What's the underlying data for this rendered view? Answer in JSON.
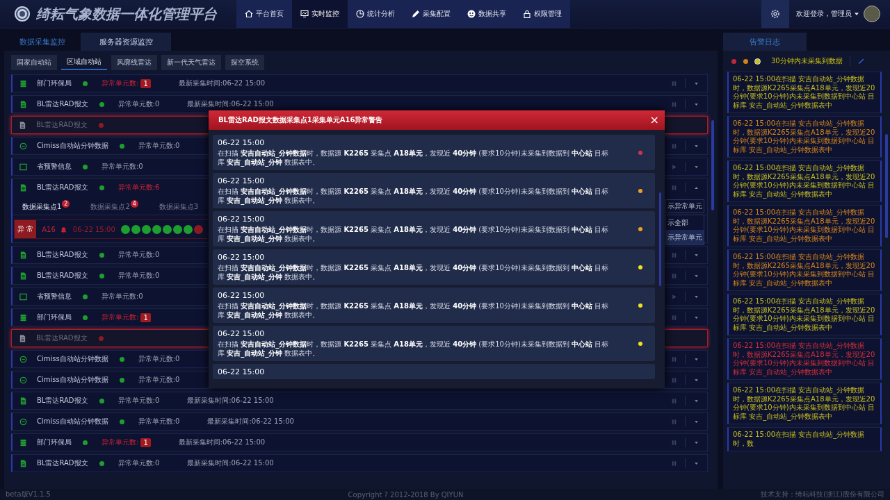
{
  "header": {
    "title": "绮耘气象数据一体化管理平台",
    "nav": [
      {
        "label": "平台首页",
        "selected": false
      },
      {
        "label": "实时监控",
        "selected": true
      },
      {
        "label": "统计分析",
        "selected": false
      },
      {
        "label": "采集配置",
        "selected": false
      },
      {
        "label": "数据共享",
        "selected": false
      },
      {
        "label": "权限管理",
        "selected": false
      }
    ],
    "welcome": "欢迎登录，管理员"
  },
  "main_tabs": [
    {
      "label": "数据采集监控",
      "selected": false
    },
    {
      "label": "服务器资源监控",
      "selected": true
    }
  ],
  "station_tabs": [
    {
      "label": "国家自动站",
      "selected": false
    },
    {
      "label": "区域自动站",
      "selected": true
    },
    {
      "label": "风廓线雷达",
      "selected": false
    },
    {
      "label": "新一代天气雷达",
      "selected": false
    },
    {
      "label": "探空系统",
      "selected": false
    }
  ],
  "rows": [
    {
      "kind": "database",
      "name": "部门环保局",
      "alarm": false,
      "count": "异常单元数:",
      "warning": true,
      "badge": "1",
      "updated": "最新采集时间:06-22 15:00",
      "running": true,
      "expanded": false
    },
    {
      "kind": "document",
      "name": "BL雷达RAD报文",
      "alarm": false,
      "count": "异常单元数:0",
      "warning": false,
      "updated": "最新采集时间:06-22 15:00",
      "running": true,
      "expanded": false
    },
    {
      "kind": "document",
      "name": "BL雷达RAD报文",
      "alarm": true
    },
    {
      "kind": "circle",
      "name": "Cimiss自动站分钟数据",
      "alarm": false,
      "count": "异常单元数:0",
      "warning": false,
      "running": true,
      "expanded": false
    },
    {
      "kind": "window",
      "name": "省预警信息",
      "alarm": false,
      "count": "异常单元数:0",
      "warning": false,
      "running": false,
      "expanded": false
    },
    {
      "kind": "document",
      "name": "BL雷达RAD报文",
      "alarm": false,
      "count": "异常单元数:6",
      "warning": true,
      "running": true,
      "expanded": true,
      "points": [
        {
          "label": "数据采集点1",
          "badge": "2",
          "selected": true
        },
        {
          "label": "数据采集点2",
          "badge": "4",
          "selected": false
        },
        {
          "label": "数据采集点3",
          "selected": false
        }
      ],
      "unit": {
        "status": "异 常",
        "name": "A16",
        "time": "06-22 15:00",
        "cells": [
          {
            "color": "#1e9e2e"
          },
          {
            "color": "#1e9e2e"
          },
          {
            "color": "#1e9e2e"
          },
          {
            "color": "#1e9e2e"
          },
          {
            "color": "#1e9e2e"
          },
          {
            "color": "#1e9e2e"
          },
          {
            "color": "#1e9e2e"
          },
          {
            "color": "#8e1a22"
          }
        ]
      },
      "filter": {
        "value": "示异常单元",
        "options": [
          {
            "label": "示全部",
            "selected": false
          },
          {
            "label": "示异常单元",
            "selected": true
          }
        ]
      }
    },
    {
      "kind": "document",
      "name": "BL雷达RAD报文",
      "alarm": false,
      "count": "异常单元数:0",
      "warning": false,
      "running": true,
      "expanded": false
    },
    {
      "kind": "document",
      "name": "BL雷达RAD报文",
      "alarm": false,
      "count": "异常单元数:0",
      "warning": false,
      "running": true,
      "expanded": false
    },
    {
      "kind": "window",
      "name": "省预警信息",
      "alarm": false,
      "count": "异常单元数:0",
      "warning": false,
      "running": false,
      "expanded": false
    },
    {
      "kind": "database",
      "name": "部门环保局",
      "alarm": false,
      "count": "异常单元数:",
      "warning": true,
      "badge": "1",
      "running": true,
      "expanded": false
    },
    {
      "kind": "document",
      "name": "BL雷达RAD报文",
      "alarm": true
    },
    {
      "kind": "circle",
      "name": "Cimiss自动站分钟数据",
      "alarm": false,
      "count": "异常单元数:0",
      "warning": false,
      "running": true,
      "expanded": false
    },
    {
      "kind": "circle",
      "name": "Cimiss自动站分钟数据",
      "alarm": false,
      "count": "异常单元数:0",
      "warning": false,
      "running": true,
      "expanded": false
    },
    {
      "kind": "document",
      "name": "BL雷达RAD报文",
      "alarm": false,
      "count": "异常单元数:0",
      "warning": false,
      "updated": "最新采集时间:06-22 15:00",
      "running": true,
      "expanded": false
    },
    {
      "kind": "circle",
      "name": "Cimiss自动站分钟数据",
      "alarm": false,
      "count": "异常单元数:0",
      "warning": false,
      "updated": "最新采集时间:06-22 15:00",
      "running": true,
      "expanded": false
    },
    {
      "kind": "database",
      "name": "部门环保局",
      "alarm": false,
      "count": "异常单元数:",
      "warning": true,
      "badge": "1",
      "updated": "最新采集时间:06-22 15:00",
      "running": true,
      "expanded": false
    },
    {
      "kind": "document",
      "name": "BL雷达RAD报文",
      "alarm": false,
      "count": "异常单元数:0",
      "warning": false,
      "updated": "最新采集时间:06-22 15:00",
      "running": true,
      "expanded": false
    }
  ],
  "alert_log": {
    "tab": "告警日志",
    "levels": [
      {
        "color": "#c0283a",
        "selected": false
      },
      {
        "color": "#d08418",
        "selected": false
      },
      {
        "color": "#c8c018",
        "selected": true
      }
    ],
    "filter_label": "30分钟内未采集到数据",
    "entries": [
      {
        "color": "#c8c020",
        "text": "06-22 15:00在扫描 安吉自动站_分钟数据时，数据源K2265采集点A18单元，发现近20分钟(要求10分钟)内未采集到数据到中心站 目标库 安吉_自动站_分钟数据表中"
      },
      {
        "color": "#d8881c",
        "text": "06-22 15:00在扫描 安吉自动站_分钟数据时，数据源K2265采集点A18单元，发现近20分钟(要求10分钟)内未采集到数据到中心站 目标库 安吉_自动站_分钟数据表中"
      },
      {
        "color": "#c8c020",
        "text": "06-22 15:00在扫描 安吉自动站_分钟数据时，数据源K2265采集点A18单元，发现近20分钟(要求10分钟)内未采集到数据到中心站 目标库 安吉_自动站_分钟数据表中"
      },
      {
        "color": "#d8881c",
        "text": "06-22 15:00在扫描 安吉自动站_分钟数据时，数据源K2265采集点A18单元，发现近20分钟(要求10分钟)内未采集到数据到中心站 目标库 安吉_自动站_分钟数据表中"
      },
      {
        "color": "#d8881c",
        "text": "06-22 15:00在扫描 安吉自动站_分钟数据时，数据源K2265采集点A18单元，发现近20分钟(要求10分钟)内未采集到数据到中心站 目标库 安吉_自动站_分钟数据表中"
      },
      {
        "color": "#c8c020",
        "text": "06-22 15:00在扫描 安吉自动站_分钟数据时，数据源K2265采集点A18单元，发现近20分钟(要求10分钟)内未采集到数据到中心站 目标库 安吉_自动站_分钟数据表中"
      },
      {
        "color": "#d8303c",
        "text": "06-22 15:00在扫描 安吉自动站_分钟数据时，数据源K2265采集点A18单元，发现近20分钟(要求10分钟)内未采集到数据到中心站 目标库 安吉_自动站_分钟数据表中"
      },
      {
        "color": "#c8c020",
        "text": "06-22 15:00在扫描 安吉自动站_分钟数据时，数据源K2265采集点A18单元，发现近20分钟(要求10分钟)内未采集到数据到中心站 目标库 安吉_自动站_分钟数据表中"
      },
      {
        "color": "#c8c020",
        "text": "06-22 15:00在扫描 安吉自动站_分钟数据时，数"
      }
    ]
  },
  "dialog": {
    "title": "BL雷达RAD报文数据采集点1采集单元A16异常警告",
    "close": "×",
    "items": [
      {
        "time": "06-22 15:00",
        "color": "#d0334a",
        "message": "在扫描 **安吉自动站_分钟数据**时，数据源 **K2265** 采集点 **A18单元**，发现近 **40分钟** (要求10分钟)未采集到数据到 **中心站** 目标库 **安吉_自动站_分钟** 数据表中。"
      },
      {
        "time": "06-22 15:00",
        "color": "#f0a020",
        "message": "在扫描 **安吉自动站_分钟数据**时，数据源 **K2265** 采集点 **A18单元**，发现近 **40分钟** (要求10分钟)未采集到数据到 **中心站** 目标库 **安吉_自动站_分钟** 数据表中。"
      },
      {
        "time": "06-22 15:00",
        "color": "#f0a020",
        "message": "在扫描 **安吉自动站_分钟数据**时，数据源 **K2265** 采集点 **A18单元**，发现近 **40分钟** (要求10分钟)未采集到数据到 **中心站** 目标库 **安吉_自动站_分钟** 数据表中。"
      },
      {
        "time": "06-22 15:00",
        "color": "#f5e020",
        "message": "在扫描 **安吉自动站_分钟数据**时，数据源 **K2265** 采集点 **A18单元**，发现近 **40分钟** (要求10分钟)未采集到数据到 **中心站** 目标库 **安吉_自动站_分钟** 数据表中。"
      },
      {
        "time": "06-22 15:00",
        "color": "#f5e020",
        "message": "在扫描 **安吉自动站_分钟数据**时，数据源 **K2265** 采集点 **A18单元**，发现近 **40分钟** (要求10分钟)未采集到数据到 **中心站** 目标库 **安吉_自动站_分钟** 数据表中。"
      },
      {
        "time": "06-22 15:00",
        "color": "#f5e020",
        "message": "在扫描 **安吉自动站_分钟数据**时，数据源 **K2265** 采集点 **A18单元**，发现近 **40分钟** (要求10分钟)未采集到数据到 **中心站** 目标库 **安吉_自动站_分钟** 数据表中。"
      },
      {
        "time": "06-22 15:00"
      }
    ]
  },
  "footer": {
    "version": "beta版V1.1.5",
    "copyright": "Copyright ? 2012-2018 By QIYUN",
    "support": "技术支持：绮耘科技(浙江)股份有限公司"
  }
}
